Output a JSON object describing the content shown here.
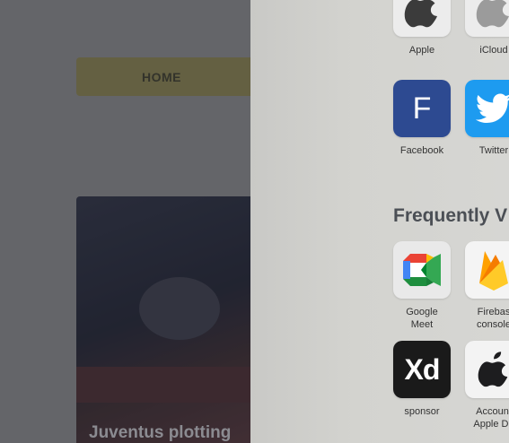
{
  "background_page": {
    "nav_home": "HOME",
    "headline": "Juventus plotting"
  },
  "start_page": {
    "favorites": [
      {
        "label": "Apple",
        "icon": "apple-logo-icon"
      },
      {
        "label": "iCloud",
        "icon": "apple-logo-icon"
      },
      {
        "label": "Facebook",
        "icon": "facebook-f-icon",
        "glyph": "F"
      },
      {
        "label": "Twitter",
        "icon": "twitter-bird-icon"
      }
    ],
    "frequently_visited_title": "Frequently V",
    "frequently_visited": [
      {
        "label_line1": "Google",
        "label_line2": "Meet",
        "icon": "google-meet-icon"
      },
      {
        "label_line1": "Firebas",
        "label_line2": "console",
        "icon": "firebase-icon"
      },
      {
        "label_line1": "sponsor",
        "label_line2": "",
        "icon": "adobe-xd-icon",
        "glyph": "Xd"
      },
      {
        "label_line1": "Account",
        "label_line2": "Apple De",
        "icon": "apple-logo-icon"
      }
    ]
  },
  "colors": {
    "facebook_tile": "#2d4a91",
    "twitter_tile": "#1d9bf0",
    "xd_tile": "#1a1a1a",
    "panel_bg": "#d3d3cf"
  }
}
